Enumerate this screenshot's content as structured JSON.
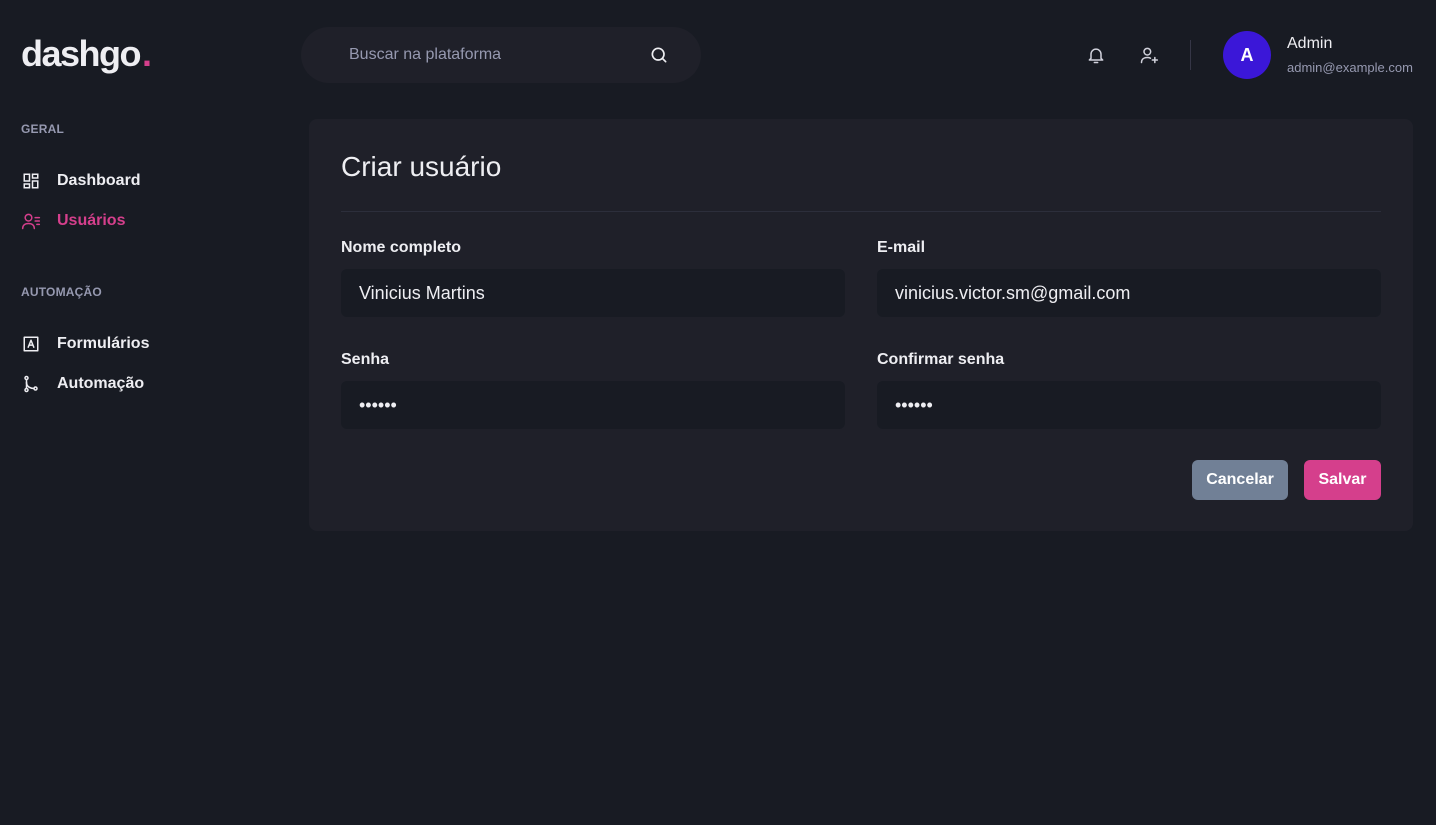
{
  "app": {
    "logo_text": "dashgo",
    "logo_dot": "."
  },
  "search": {
    "placeholder": "Buscar na plataforma"
  },
  "user": {
    "avatar_initial": "A",
    "name": "Admin",
    "email": "admin@example.com"
  },
  "sidebar": {
    "sections": [
      {
        "title": "GERAL",
        "items": [
          {
            "label": "Dashboard",
            "icon": "dashboard-icon"
          },
          {
            "label": "Usuários",
            "icon": "users-icon",
            "active": true
          }
        ]
      },
      {
        "title": "AUTOMAÇÃO",
        "items": [
          {
            "label": "Formulários",
            "icon": "form-icon"
          },
          {
            "label": "Automação",
            "icon": "git-branch-icon"
          }
        ]
      }
    ]
  },
  "form": {
    "title": "Criar usuário",
    "fields": [
      {
        "label": "Nome completo",
        "value": "Vinicius Martins"
      },
      {
        "label": "E-mail",
        "value": "vinicius.victor.sm@gmail.com"
      },
      {
        "label": "Senha",
        "value": "••••••"
      },
      {
        "label": "Confirmar senha",
        "value": "••••••"
      }
    ],
    "cancel_label": "Cancelar",
    "save_label": "Salvar"
  },
  "colors": {
    "background": "#181b23",
    "panel": "#1f2029",
    "accent": "#d53f8c",
    "avatar": "#3b17d8",
    "cancel_button": "#718096"
  }
}
